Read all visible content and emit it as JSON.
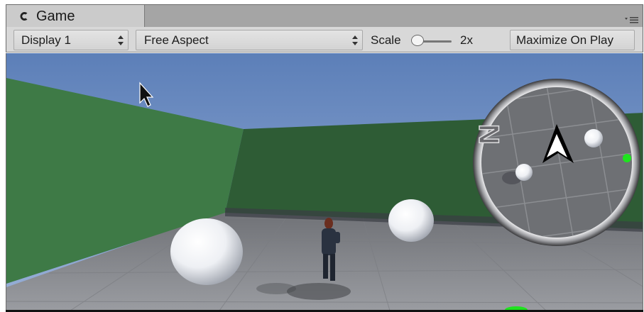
{
  "window": {
    "tab_title": "Game",
    "tab_icon": "unity-game-icon",
    "menu_icon": "panel-menu-icon"
  },
  "toolbar": {
    "display_label": "Display 1",
    "aspect_label": "Free Aspect",
    "scale_label": "Scale",
    "scale_value": "2x",
    "scale_level": 0.15,
    "maximize_label": "Maximize On Play"
  },
  "minimap": {
    "north_label": "N",
    "player_arrow": "player-arrow-icon",
    "marker_color": "#1ee31e"
  },
  "colors": {
    "sky_top": "#5c7fb8",
    "sky_bottom": "#9ab1d8",
    "wall_left": "#3e7a46",
    "wall_back": "#2e5c35",
    "floor": "#8d8f94",
    "tab_bg": "#cbcbcb",
    "toolbar_bg": "#d8d8d8"
  }
}
